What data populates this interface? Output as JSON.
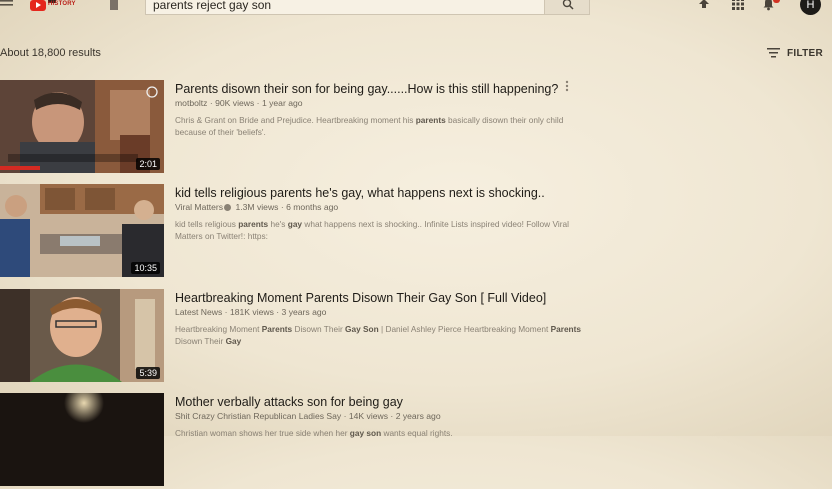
{
  "header": {
    "logo_text": "HISTORY",
    "search_value": "parents reject gay son",
    "avatar_initial": "H",
    "icons": [
      "menu-icon",
      "search-icon",
      "upload-icon",
      "apps-icon",
      "bell-icon"
    ],
    "accent_color": "#e5271d"
  },
  "results_count": "About 18,800 results",
  "filter_label": "FILTER",
  "results": [
    {
      "title": "Parents disown their son for being gay......How is this still happening?",
      "channel": "motboltz",
      "views": "90K views",
      "age": "1 year ago",
      "desc_pre": "Chris & Grant on Bride and Prejudice. Heartbreaking moment his ",
      "desc_b1": "parents",
      "desc_post": " basically disown their only child because of their 'beliefs'.",
      "duration": "2:01",
      "thumb_caption": "So you think it's worth sacrificing your relationship with me because of your beliefs?"
    },
    {
      "title": "kid tells religious parents he's gay, what happens next is shocking..",
      "channel": "Viral Matters",
      "views": "1.3M views",
      "age": "6 months ago",
      "desc_pre": "kid tells religious ",
      "desc_b1": "parents",
      "desc_mid": " he's ",
      "desc_b2": "gay",
      "desc_post": " what happens next is shocking.. Infinite Lists inspired video! Follow Viral Matters on Twitter!: https:",
      "duration": "10:35"
    },
    {
      "title": "Heartbreaking Moment Parents Disown Their Gay Son [ Full Video]",
      "channel": "Latest News",
      "views": "181K views",
      "age": "3 years ago",
      "desc_pre": "Heartbreaking Moment ",
      "desc_b1": "Parents",
      "desc_mid": " Disown Their ",
      "desc_b2": "Gay Son",
      "desc_mid2": " | Daniel Ashley Pierce Heartbreaking Moment ",
      "desc_b3": "Parents",
      "desc_mid3": " Disown Their ",
      "desc_b4": "Gay",
      "duration": "5:39"
    },
    {
      "title": "Mother verbally attacks son for being gay",
      "channel": "Shit Crazy Christian Republican Ladies Say",
      "views": "14K views",
      "age": "2 years ago",
      "desc_pre": "Christian woman shows her true side when her ",
      "desc_b1": "gay son",
      "desc_post": " wants equal rights."
    }
  ]
}
